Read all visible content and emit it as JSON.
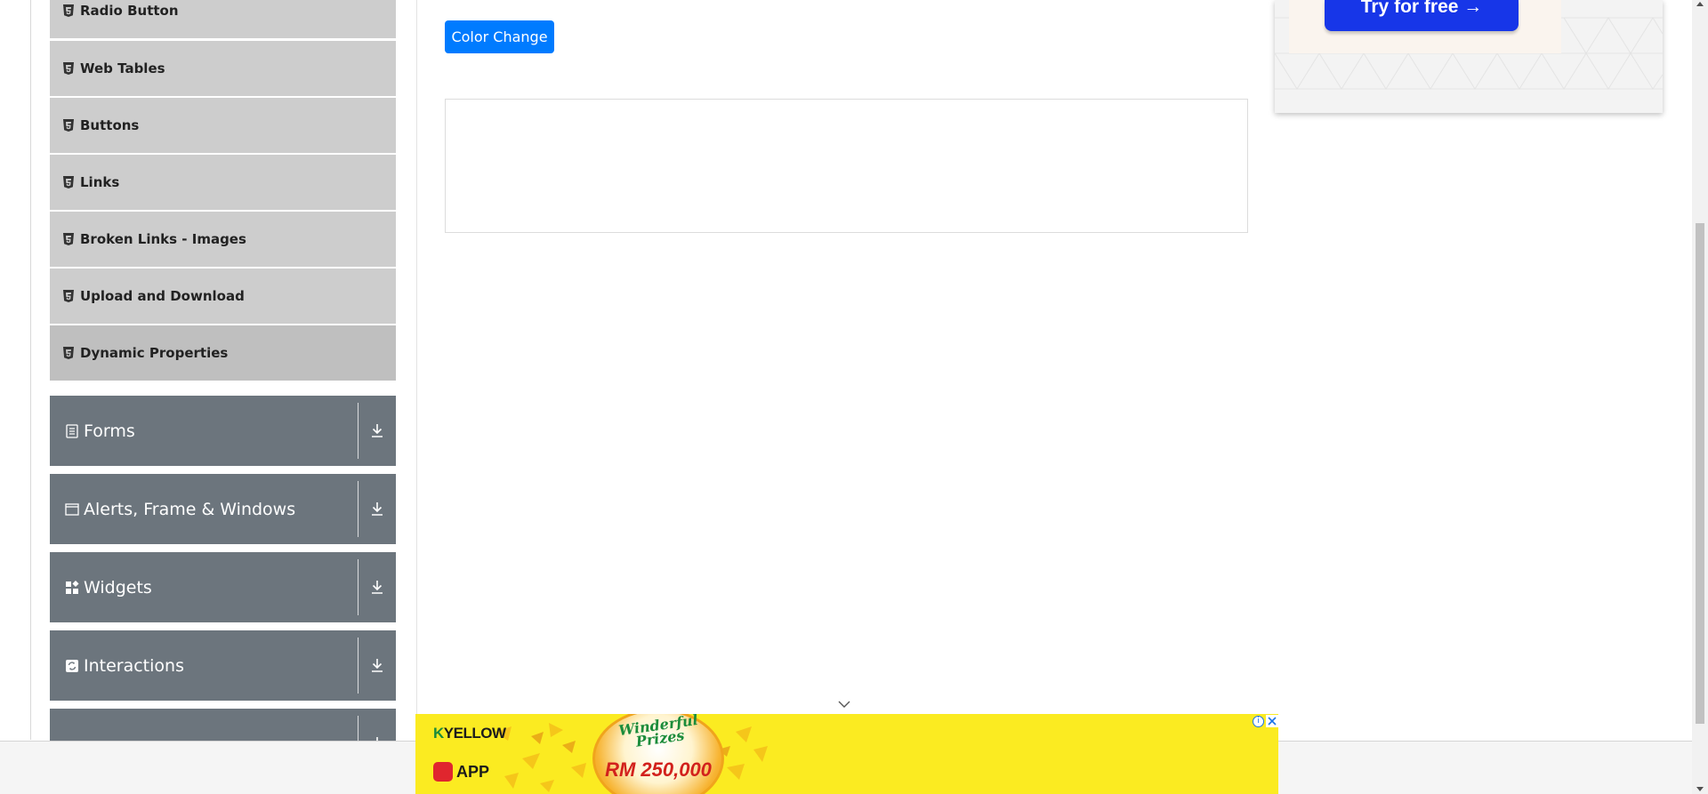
{
  "sidebar": {
    "sub_items": [
      {
        "label": "Radio Button",
        "icon": "html5-shield-icon",
        "active": false
      },
      {
        "label": "Web Tables",
        "icon": "html5-shield-icon",
        "active": false
      },
      {
        "label": "Buttons",
        "icon": "html5-shield-icon",
        "active": false
      },
      {
        "label": "Links",
        "icon": "html5-shield-icon",
        "active": false
      },
      {
        "label": "Broken Links - Images",
        "icon": "html5-shield-icon",
        "active": false
      },
      {
        "label": "Upload and Download",
        "icon": "html5-shield-icon",
        "active": false
      },
      {
        "label": "Dynamic Properties",
        "icon": "html5-shield-icon",
        "active": true
      }
    ],
    "groups": [
      {
        "label": "Forms",
        "icon": "form-icon"
      },
      {
        "label": "Alerts, Frame & Windows",
        "icon": "window-icon"
      },
      {
        "label": "Widgets",
        "icon": "widgets-icon"
      },
      {
        "label": "Interactions",
        "icon": "interactions-icon"
      }
    ]
  },
  "main": {
    "color_change_label": "Color Change"
  },
  "right_ad": {
    "cta_label": "Try for free →"
  },
  "bottom_ad": {
    "brand_prefix": "K",
    "brand_name": "YELLOW",
    "app_label": "APP",
    "headline": "Winderful Prizes",
    "prize_amount": "RM 250,000",
    "info_glyph": "i"
  },
  "colors": {
    "sub_item_bg": "#cdcdcd",
    "group_bg": "#6c757d",
    "primary_button": "#007bff",
    "ad_yellow": "#fbeb21",
    "cta_blue": "#1736e8"
  }
}
